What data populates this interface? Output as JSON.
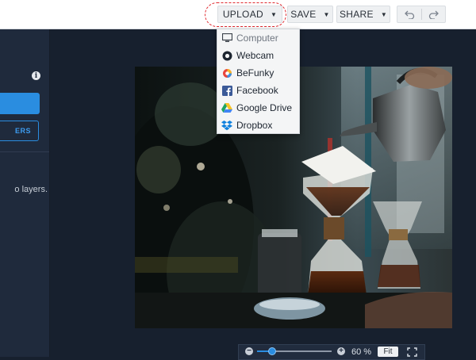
{
  "toolbar": {
    "upload_label": "UPLOAD",
    "save_label": "SAVE",
    "share_label": "SHARE",
    "undo_icon": "undo-icon",
    "redo_icon": "redo-icon"
  },
  "upload_menu": {
    "items": [
      {
        "label": "Computer",
        "icon": "monitor-icon",
        "state": "disabled"
      },
      {
        "label": "Webcam",
        "icon": "webcam-icon"
      },
      {
        "label": "BeFunky",
        "icon": "befunky-logo-icon"
      },
      {
        "label": "Facebook",
        "icon": "facebook-icon"
      },
      {
        "label": "Google Drive",
        "icon": "google-drive-icon"
      },
      {
        "label": "Dropbox",
        "icon": "dropbox-icon"
      }
    ]
  },
  "left_panel": {
    "info_icon": "info-icon",
    "outline_button_label": "ERS",
    "hint_text": "o layers."
  },
  "zoom": {
    "percent_label": "60 %",
    "level": 0.2,
    "fit_label": "Fit",
    "fullscreen_icon": "fullscreen-icon"
  },
  "colors": {
    "accent": "#2a8de0",
    "highlight": "#e0282e",
    "panel_bg": "#1f2a3c",
    "canvas_bg": "#17202e"
  }
}
